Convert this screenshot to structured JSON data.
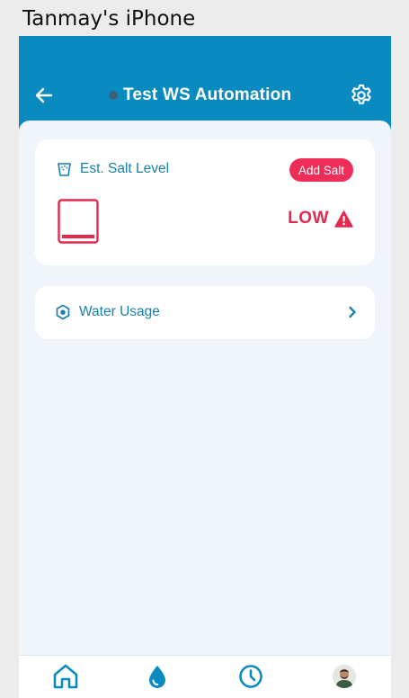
{
  "window": {
    "title": "Tanmay's iPhone"
  },
  "header": {
    "title": "Test WS Automation",
    "back_icon": "arrow-left-icon",
    "settings_icon": "gear-icon"
  },
  "salt_card": {
    "label": "Est. Salt Level",
    "button_label": "Add Salt",
    "level_text": "LOW",
    "level_fraction": 0.1,
    "warning_icon": "warning-triangle-icon"
  },
  "usage_card": {
    "label": "Water Usage",
    "icon": "hexagon-icon"
  },
  "bottom_nav": {
    "items": [
      {
        "icon": "home-icon"
      },
      {
        "icon": "water-drop-icon"
      },
      {
        "icon": "clock-icon"
      },
      {
        "icon": "user-avatar"
      }
    ]
  },
  "colors": {
    "primary": "#0a8bc0",
    "background": "#eff5fa",
    "alert": "#ee2d59",
    "label": "#1a7fab"
  }
}
